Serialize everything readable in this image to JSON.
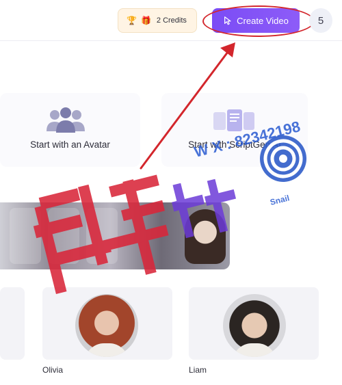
{
  "header": {
    "credits": {
      "icon": "trophy-icon",
      "gift_icon": "gift-icon",
      "label": "2 Credits"
    },
    "create_button": {
      "icon": "cursor-pointer-icon",
      "label": "Create Video"
    },
    "user_badge": "5"
  },
  "start_options": [
    {
      "icon": "avatar-team-icon",
      "label": "Start with an Avatar"
    },
    {
      "icon": "script-document-icon",
      "label": "Start with ScriptGen AI"
    }
  ],
  "avatars": [
    {
      "name": "Olivia"
    },
    {
      "name": "Liam"
    }
  ],
  "watermark": {
    "text": "W X : 82342198",
    "brand": "Snail"
  },
  "colors": {
    "accent": "#7b4cf5",
    "annotation": "#d3262c",
    "credits_bg": "#fff4e4",
    "watermark": "#d9263a"
  }
}
